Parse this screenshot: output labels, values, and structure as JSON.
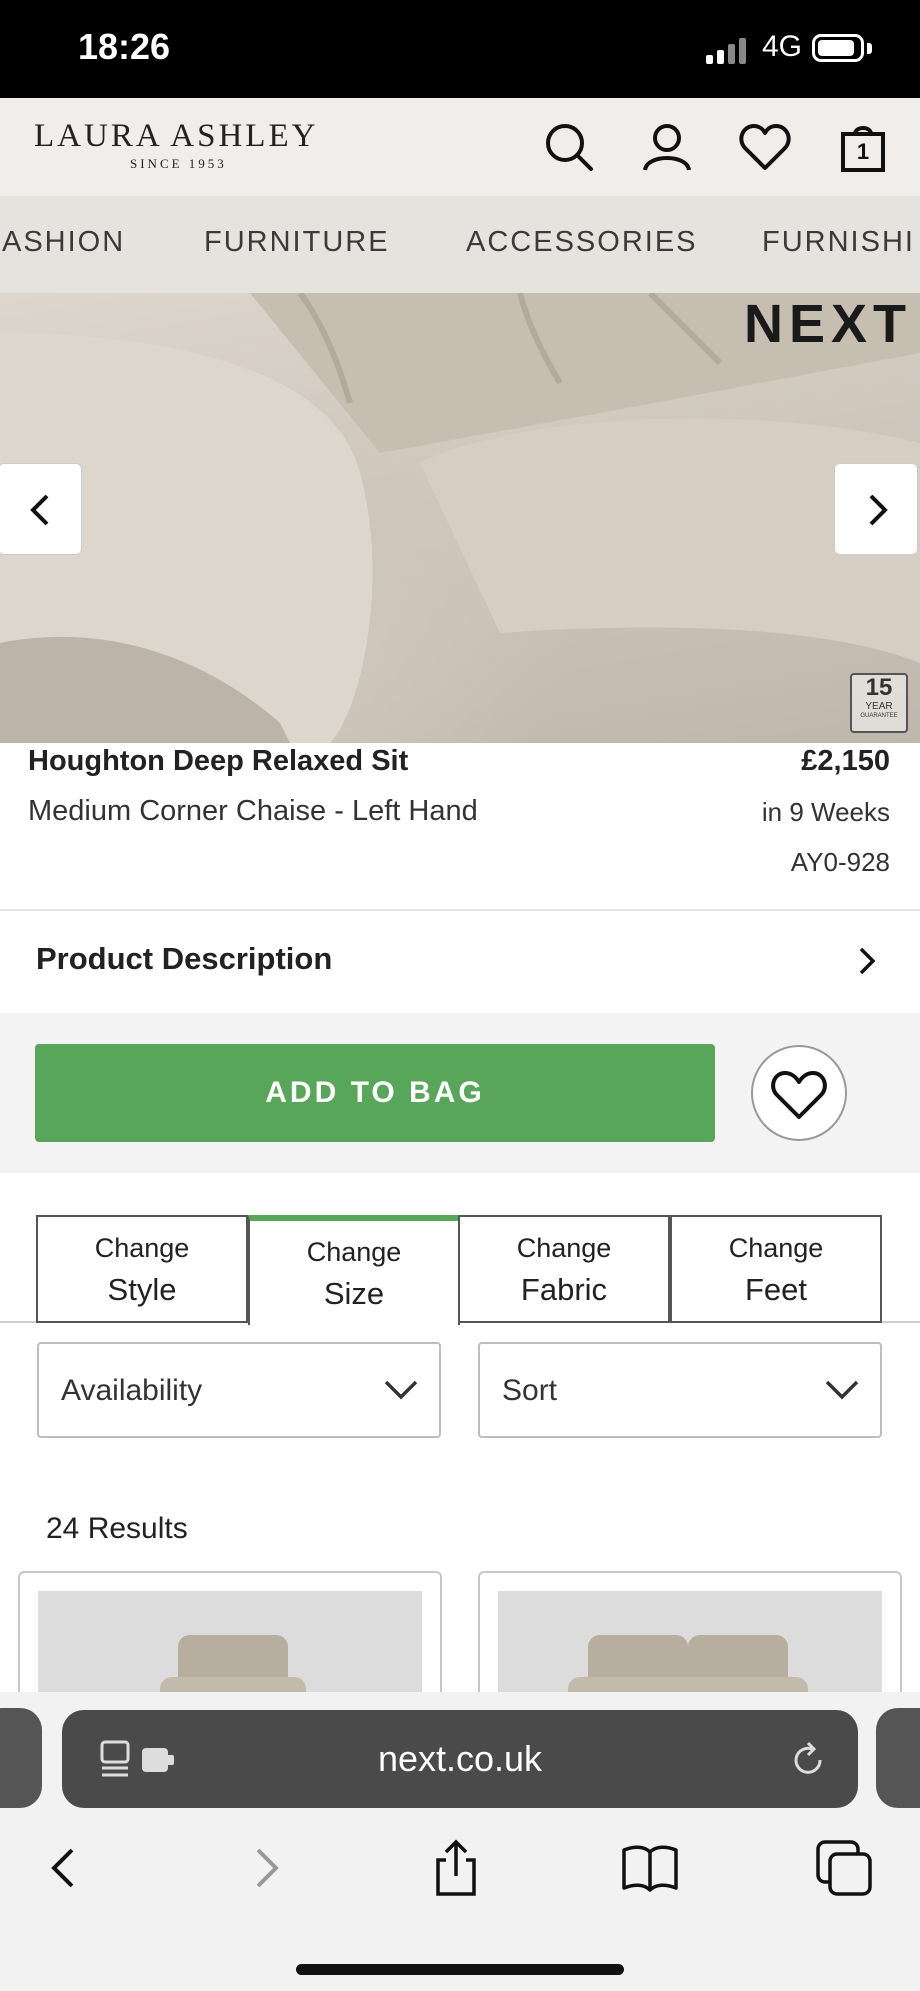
{
  "status_bar": {
    "time": "18:26",
    "network": "4G"
  },
  "header": {
    "logo_main": "LAURA ASHLEY",
    "logo_sub": "SINCE 1953",
    "bag_count": "1"
  },
  "nav": {
    "items": [
      "ASHION",
      "FURNITURE",
      "ACCESSORIES",
      "FURNISHI"
    ]
  },
  "hero": {
    "brand": "NEXT",
    "badge_number": "15",
    "badge_line1": "YEAR",
    "badge_line2": "GUARANTEE"
  },
  "product": {
    "title": "Houghton Deep Relaxed Sit",
    "subtitle": "Medium Corner Chaise - Left Hand",
    "price": "£2,150",
    "delivery": "in 9 Weeks",
    "code": "AY0-928"
  },
  "description": {
    "label": "Product Description"
  },
  "actions": {
    "add_to_bag": "ADD TO BAG"
  },
  "tabs": [
    {
      "line1": "Change",
      "line2": "Style"
    },
    {
      "line1": "Change",
      "line2": "Size"
    },
    {
      "line1": "Change",
      "line2": "Fabric"
    },
    {
      "line1": "Change",
      "line2": "Feet"
    }
  ],
  "active_tab": "Size",
  "filters": {
    "availability": "Availability",
    "sort": "Sort"
  },
  "results": {
    "count_label": "24 Results"
  },
  "browser": {
    "url": "next.co.uk"
  },
  "colors": {
    "accent_green": "#58a659",
    "header_bg": "#f1edea",
    "nav_bg": "#e6e2de"
  }
}
